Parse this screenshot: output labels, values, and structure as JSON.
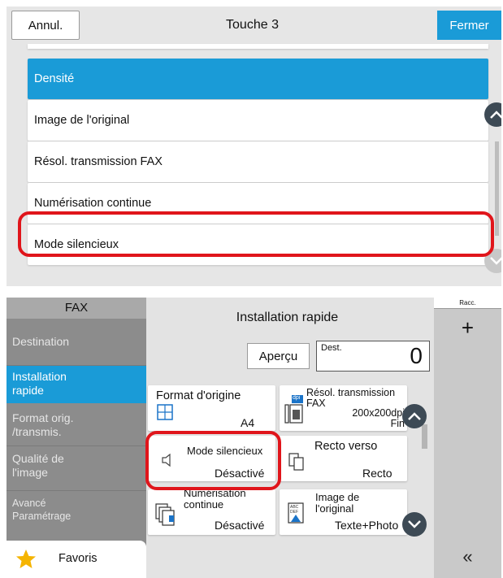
{
  "top_dialog": {
    "cancel_label": "Annul.",
    "title": "Touche 3",
    "close_label": "Fermer",
    "items": [
      {
        "label": "Densité",
        "selected": true
      },
      {
        "label": "Image de l'original",
        "selected": false
      },
      {
        "label": "Résol. transmission FAX",
        "selected": false
      },
      {
        "label": "Numérisation continue",
        "selected": false
      },
      {
        "label": "Mode silencieux",
        "selected": false
      }
    ]
  },
  "fax_screen": {
    "side_title": "FAX",
    "nav": [
      {
        "label": "Destination"
      },
      {
        "label": "Installation rapide",
        "active": true
      },
      {
        "label": "Format orig. /transmis."
      },
      {
        "label": "Qualité de l'image"
      },
      {
        "label": "Avancé Paramétrage"
      }
    ],
    "favorites_label": "Favoris",
    "title": "Installation rapide",
    "preview_label": "Aperçu",
    "dest_label": "Dest.",
    "dest_count": "0",
    "tiles": {
      "format": {
        "title": "Format d'origine",
        "value": "A4"
      },
      "resolution": {
        "title": "Résol. transmission FAX",
        "value": "200x200dpi Fin",
        "icon_text": "dpi"
      },
      "silent": {
        "title": "Mode silencieux",
        "value": "Désactivé"
      },
      "duplex": {
        "title": "Recto verso",
        "value": "Recto"
      },
      "continuous": {
        "title": "Numérisation continue",
        "value": "Désactivé"
      },
      "original_image": {
        "title": "Image de l'original",
        "value": "Texte+Photo",
        "icon_text": "ABC DEF"
      }
    },
    "right_panel": {
      "label": "Racc.",
      "add": "+",
      "collapse": "«"
    }
  },
  "colors": {
    "accent": "#1a9bd7",
    "highlight": "#e0151b",
    "nav_bg": "#8c8c8c"
  }
}
